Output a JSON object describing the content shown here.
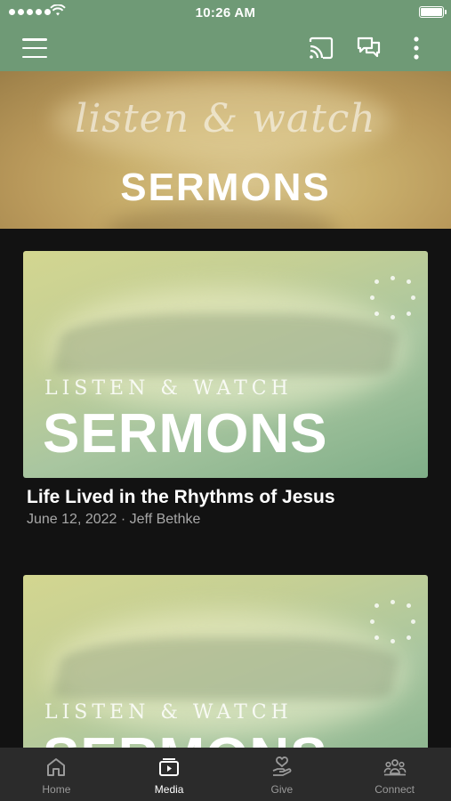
{
  "status_bar": {
    "time": "10:26 AM",
    "signal_icon": "signal-dots-icon",
    "wifi_icon": "wifi-icon",
    "battery_icon": "battery-icon"
  },
  "app_bar": {
    "background": "#6f9a76",
    "menu_icon": "hamburger-menu-icon",
    "actions": [
      "cast-icon",
      "chat-icon",
      "more-vertical-icon"
    ]
  },
  "hero": {
    "script_text": "listen & watch",
    "title": "SERMONS"
  },
  "sermons": [
    {
      "thumb_line1": "LISTEN & WATCH",
      "thumb_line2": "SERMONS",
      "title": "Life Lived in the Rhythms of Jesus",
      "meta": "June 12, 2022 · Jeff Bethke"
    },
    {
      "thumb_line1": "LISTEN & WATCH",
      "thumb_line2": "SERMONS"
    }
  ],
  "tab_bar": {
    "tabs": [
      {
        "label": "Home",
        "icon": "home-icon"
      },
      {
        "label": "Media",
        "icon": "media-play-icon"
      },
      {
        "label": "Give",
        "icon": "give-heart-hand-icon"
      },
      {
        "label": "Connect",
        "icon": "connect-people-icon"
      }
    ],
    "active": "Media"
  }
}
